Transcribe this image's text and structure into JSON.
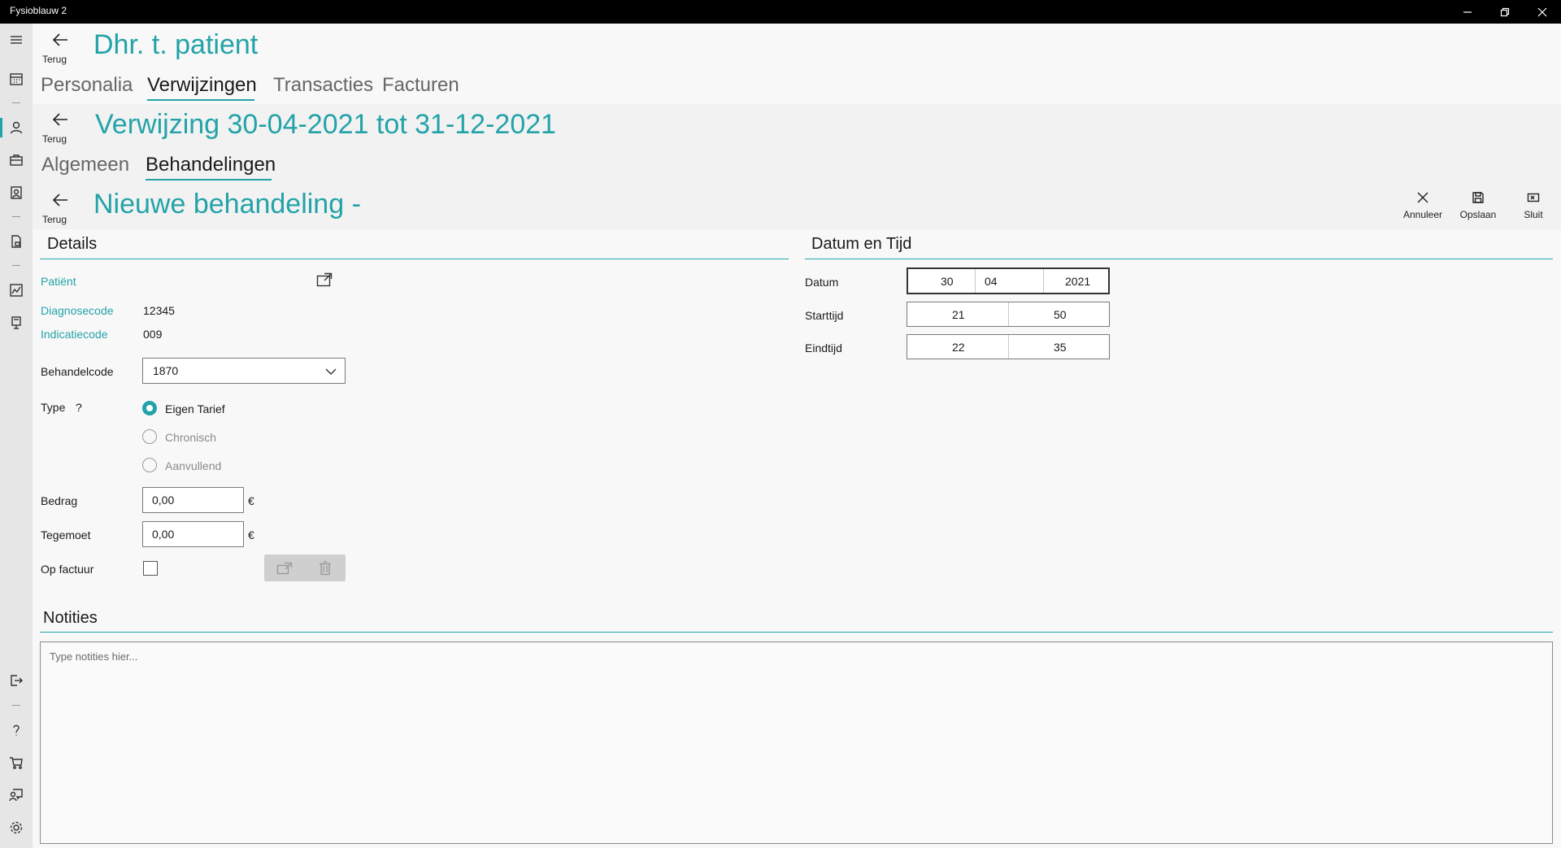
{
  "window": {
    "title": "Fysioblauw 2"
  },
  "back_label": "Terug",
  "patient": {
    "title": "Dhr. t.  patient",
    "tabs": [
      "Personalia",
      "Verwijzingen",
      "Transacties",
      "Facturen"
    ],
    "active_tab": "Verwijzingen"
  },
  "referral": {
    "title": "Verwijzing 30-04-2021 tot 31-12-2021",
    "tabs": [
      "Algemeen",
      "Behandelingen"
    ],
    "active_tab": "Behandelingen"
  },
  "treatment": {
    "title": "Nieuwe behandeling -",
    "commands": {
      "cancel": "Annuleer",
      "save": "Opslaan",
      "close": "Sluit"
    }
  },
  "details": {
    "heading": "Details",
    "patient_label": "Patiënt",
    "diagnosis_label": "Diagnosecode",
    "diagnosis_value": "12345",
    "indication_label": "Indicatiecode",
    "indication_value": "009",
    "treatment_code_label": "Behandelcode",
    "treatment_code_value": "1870",
    "type_label": "Type",
    "type_help": "?",
    "type_options": [
      "Eigen Tarief",
      "Chronisch",
      "Aanvullend"
    ],
    "type_selected": "Eigen Tarief",
    "amount_label": "Bedrag",
    "amount_value": "0,00",
    "contribution_label": "Tegemoet",
    "contribution_value": "0,00",
    "currency": "€",
    "on_invoice_label": "Op factuur",
    "on_invoice_checked": false
  },
  "datetime": {
    "heading": "Datum en Tijd",
    "date_label": "Datum",
    "date": {
      "day": "30",
      "month": "04",
      "year": "2021"
    },
    "start_label": "Starttijd",
    "start": {
      "hour": "21",
      "minute": "50"
    },
    "end_label": "Eindtijd",
    "end": {
      "hour": "22",
      "minute": "35"
    }
  },
  "notes": {
    "heading": "Notities",
    "placeholder": "Type notities hier...",
    "value": ""
  },
  "sidebar": {
    "icons": [
      "menu-icon",
      "calendar-icon",
      "person-icon",
      "briefcase-icon",
      "contact-card-icon",
      "document-lock-icon",
      "chart-icon",
      "payment-terminal-icon",
      "sign-out-icon",
      "help-icon",
      "cart-icon",
      "support-chat-icon",
      "settings-icon"
    ],
    "active": "person-icon"
  },
  "colors": {
    "accent": "#23a3a8",
    "titlebar": "#000000",
    "sidebar": "#e6e6e6",
    "background": "#f8f8f8"
  }
}
